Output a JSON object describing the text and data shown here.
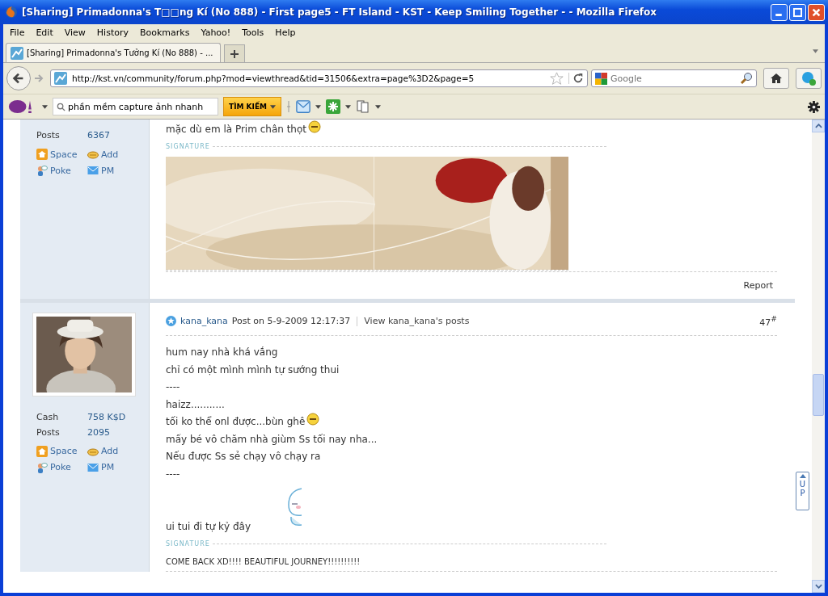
{
  "window": {
    "title": "[Sharing] Primadonna's T□□ng Kí (No 888) - First page5 - FT Island - KST - Keep Smiling Together - - Mozilla Firefox"
  },
  "menu": [
    "File",
    "Edit",
    "View",
    "History",
    "Bookmarks",
    "Yahoo!",
    "Tools",
    "Help"
  ],
  "tabs": [
    {
      "label": "[Sharing] Primadonna's Tưởng Kí (No 888) - ...",
      "selected": true
    }
  ],
  "address_bar": {
    "value": "http://kst.vn/community/forum.php?mod=viewthread&tid=31506&extra=page%3D2&page=5"
  },
  "search_bar": {
    "placeholder": "Google"
  },
  "yahoo_toolbar": {
    "search_value": "phần mềm capture ảnh nhanh",
    "search_button": "TÌM KIẾM"
  },
  "posts": [
    {
      "author_stats": [
        {
          "label": "Posts",
          "value": "6367"
        }
      ],
      "actions": [
        "Space",
        "Add",
        "Poke",
        "PM"
      ],
      "body": [
        {
          "kind": "emoticon_text",
          "text": "mặc dù em là Prim chân thọt"
        }
      ],
      "signature_label": "SIGNATURE",
      "signature": {
        "kind": "picture"
      },
      "footer": "Report"
    },
    {
      "avatar": {
        "kind": "picture"
      },
      "author_stats": [
        {
          "label": "Cash",
          "value": "758 K$D"
        },
        {
          "label": "Posts",
          "value": "2095"
        }
      ],
      "actions": [
        "Space",
        "Add",
        "Poke",
        "PM"
      ],
      "author": "kana_kana",
      "posted": "Post on 5-9-2009 12:17:37",
      "view_posts": "View kana_kana's posts",
      "number": "47$^{#}$",
      "body": [
        {
          "kind": "text",
          "text": "hum nay nhà khá vắng"
        },
        {
          "kind": "text",
          "text": "chỉ có một mình mình tự sướng thui"
        },
        {
          "kind": "text",
          "text": "----"
        },
        {
          "kind": "text",
          "text": "haizz..........."
        },
        {
          "kind": "emoticon_text",
          "text": "tối ko thể onl được...bùn ghê"
        },
        {
          "kind": "text",
          "text": "mấy bé vô chăm nhà giùm Ss tối nay nha..."
        },
        {
          "kind": "text",
          "text": "Nếu được Ss sẻ chạy vô chạy ra"
        },
        {
          "kind": "text",
          "text": "----"
        },
        {
          "kind": "sticker"
        },
        {
          "kind": "text",
          "text": "ui tui đi tự kỷ đây"
        }
      ],
      "signature_label": "SIGNATURE",
      "signature": {
        "kind": "text",
        "text": "COME BACK XD!!!! BEAUTIFUL JOURNEY!!!!!!!!!!"
      }
    }
  ],
  "up_button": "UP"
}
